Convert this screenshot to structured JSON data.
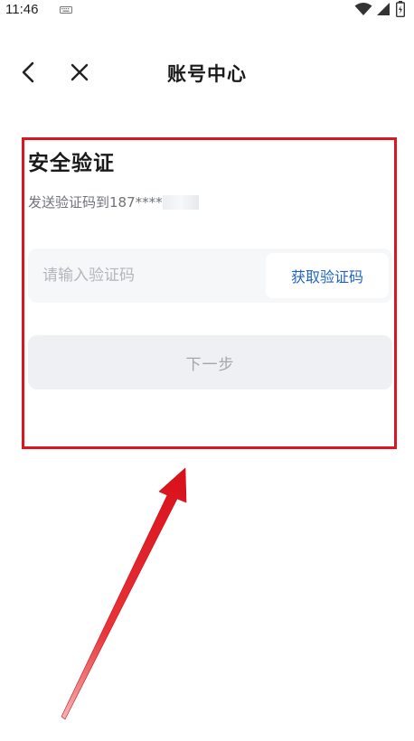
{
  "status_bar": {
    "time": "11:46"
  },
  "header": {
    "title": "账号中心"
  },
  "verify": {
    "title": "安全验证",
    "hint_prefix": "发送验证码到187****",
    "code_input_placeholder": "请输入验证码",
    "get_code_label": "获取验证码",
    "next_label": "下一步"
  },
  "colors": {
    "accent_blue": "#1e63c8",
    "annotation_red": "#e0141e",
    "disabled_text": "#a3a7ad"
  },
  "icons": {
    "back": "chevron-left-icon",
    "close": "close-icon",
    "wifi": "wifi-icon",
    "signal": "signal-icon",
    "battery": "battery-icon",
    "keyboard": "keyboard-icon"
  }
}
